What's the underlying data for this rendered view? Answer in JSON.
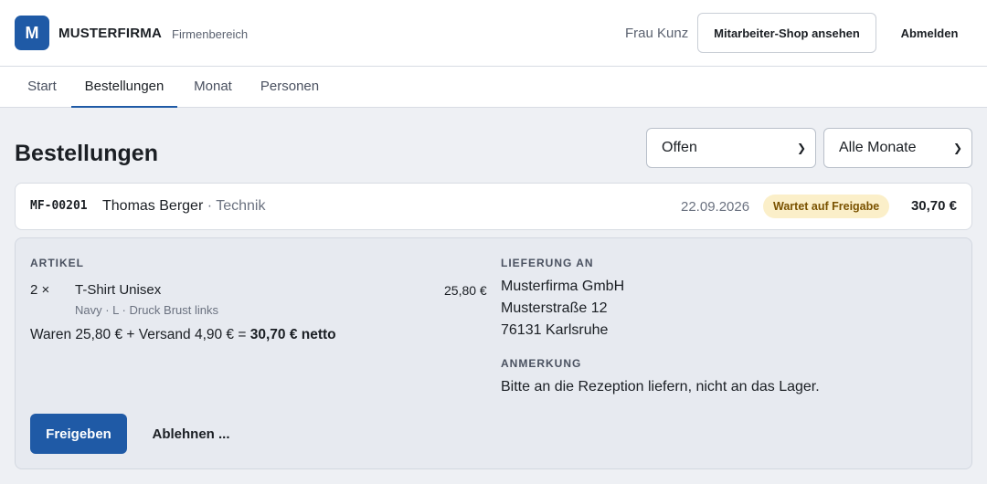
{
  "header": {
    "logo_letter": "M",
    "brand": "MUSTERFIRMA",
    "brand_sub": "Firmenbereich",
    "user": "Frau Kunz",
    "shop_button": "Mitarbeiter-Shop ansehen",
    "logout_button": "Abmelden"
  },
  "tabs": [
    {
      "label": "Start",
      "active": false
    },
    {
      "label": "Bestellungen",
      "active": true
    },
    {
      "label": "Monat",
      "active": false
    },
    {
      "label": "Personen",
      "active": false
    }
  ],
  "page": {
    "title": "Bestellungen",
    "status_filter": "Offen",
    "month_filter": "Alle Monate"
  },
  "order": {
    "id": "MF-00201",
    "person": "Thomas Berger",
    "department": "Technik",
    "separator": " · ",
    "date": "22.09.2026",
    "status": "Wartet auf Freigabe",
    "total": "30,70 €"
  },
  "detail": {
    "articles_label": "ARTIKEL",
    "item": {
      "qty": "2 ×",
      "name": "T-Shirt Unisex",
      "variant": "Navy · L · Druck Brust links",
      "price": "25,80 €"
    },
    "summary_prefix": "Waren 25,80 € + Versand 4,90 € = ",
    "summary_total": "30,70 € netto",
    "delivery_label": "LIEFERUNG AN",
    "address": [
      "Musterfirma GmbH",
      "Musterstraße 12",
      "76131 Karlsruhe"
    ],
    "note_label": "ANMERKUNG",
    "note": "Bitte an die Rezeption liefern, nicht an das Lager.",
    "approve_button": "Freigeben",
    "reject_button": "Ablehnen ..."
  },
  "colors": {
    "accent": "#1f5aa6",
    "badge_bg": "#fbefc9",
    "badge_text": "#7a5200",
    "panel_bg": "#e7eaf0"
  }
}
